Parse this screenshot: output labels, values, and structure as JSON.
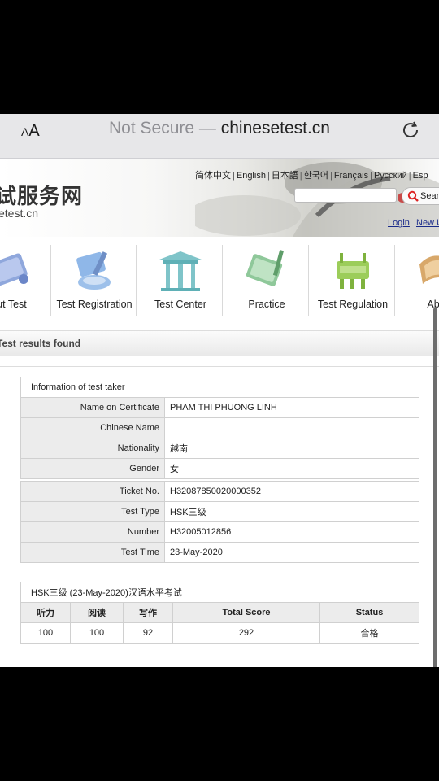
{
  "browser": {
    "aa_label_small": "A",
    "aa_label_big": "A",
    "url_prefix": "Not Secure — ",
    "url_domain": "chinesetest.cn"
  },
  "header": {
    "logo_cn": "试服务网",
    "logo_domain": "etest.cn",
    "languages": [
      "简体中文",
      "English",
      "日本語",
      "한국어",
      "Français",
      "Русский",
      "Esp"
    ],
    "search_placeholder": "",
    "search_label": "Sear",
    "login": "Login",
    "new_user": "New U"
  },
  "nav": {
    "items": [
      {
        "label": "out Test",
        "icon": "scroll-icon"
      },
      {
        "label": "Test Registration",
        "icon": "registration-icon"
      },
      {
        "label": "Test Center",
        "icon": "temple-icon"
      },
      {
        "label": "Practice",
        "icon": "practice-scroll-icon"
      },
      {
        "label": "Test Regulation",
        "icon": "bronze-vessel-icon"
      },
      {
        "label": "Abou",
        "icon": "about-icon"
      }
    ]
  },
  "results": {
    "title": "Test results found"
  },
  "taker": {
    "caption": "Information of test taker",
    "rows": [
      {
        "label": "Name on Certificate",
        "value": "PHAM THI PHUONG LINH"
      },
      {
        "label": "Chinese Name",
        "value": ""
      },
      {
        "label": "Nationality",
        "value": "越南"
      },
      {
        "label": "Gender",
        "value": "女"
      }
    ],
    "test_rows": [
      {
        "label": "Ticket No.",
        "value": "H32087850020000352"
      },
      {
        "label": "Test Type",
        "value": "HSK三级"
      },
      {
        "label": "Number",
        "value": "H32005012856"
      },
      {
        "label": "Test Time",
        "value": "23-May-2020"
      }
    ]
  },
  "scores": {
    "caption": "HSK三级 (23-May-2020)汉语水平考试",
    "headers": [
      "听力",
      "阅读",
      "写作",
      "Total Score",
      "Status"
    ],
    "values": [
      "100",
      "100",
      "92",
      "292",
      "合格"
    ]
  },
  "colors": {
    "link": "#1a2b8a",
    "label_bg": "#ececec",
    "search_icon_red": "#d22"
  }
}
